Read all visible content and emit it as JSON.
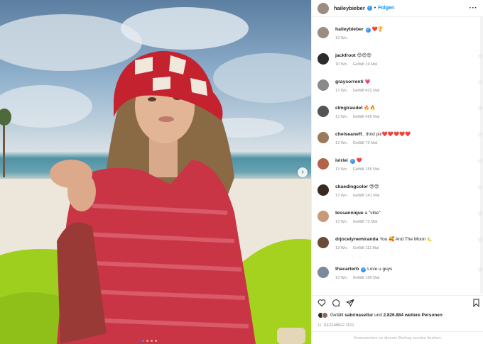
{
  "post": {
    "author": "haileybieber",
    "follow_label": "Folgen",
    "more_label": "···",
    "carousel_next": "›"
  },
  "caption": {
    "user": "haileybieber",
    "text": "❤️🏆",
    "age": "13 Wo."
  },
  "comments": [
    {
      "user": "jackfroot",
      "text": "😍😍😍",
      "age": "10 Wo.",
      "likes": "Gefällt 19 Mal",
      "avatar_color": "#2b2b2b",
      "verified": false
    },
    {
      "user": "graysorrenti",
      "text": "💗",
      "age": "13 Wo.",
      "likes": "Gefällt 422 Mal",
      "avatar_color": "#8a8a8a",
      "verified": false
    },
    {
      "user": "clmgiraudet",
      "text": "🔥🔥",
      "age": "13 Wo.",
      "likes": "Gefällt 495 Mal",
      "avatar_color": "#555555",
      "verified": false
    },
    {
      "user": "chelseaneff_",
      "text": "third pic❤️❤️❤️❤️❤️",
      "age": "13 Wo.",
      "likes": "Gefällt 73 Mal",
      "avatar_color": "#9a7a5a",
      "verified": false
    },
    {
      "user": "ivirlei",
      "text": "❤️",
      "age": "13 Wo.",
      "likes": "Gefällt 155 Mal",
      "avatar_color": "#b5624a",
      "verified": true
    },
    {
      "user": "ckaedingcolor",
      "text": "😍😍",
      "age": "13 Wo.",
      "likes": "Gefällt 141 Mal",
      "avatar_color": "#3a2a22",
      "verified": false
    },
    {
      "user": "tessannique",
      "text": "a \"vibe\"",
      "age": "13 Wo.",
      "likes": "Gefällt 73 Mal",
      "avatar_color": "#c89a7a",
      "verified": false
    },
    {
      "user": "drjocelynemiranda",
      "text": "You 🥰 And The Moon 🌜",
      "age": "13 Wo.",
      "likes": "Gefällt 111 Mal",
      "avatar_color": "#6a4a3a",
      "verified": false
    },
    {
      "user": "thacarterb",
      "text": "Love u guys",
      "age": "13 Wo.",
      "likes": "Gefällt 199 Mal",
      "avatar_color": "#7a8a9a",
      "verified": true
    }
  ],
  "likes_line": {
    "prefix": "Gefällt ",
    "first_user": "sabrinasetlur",
    "middle": " und ",
    "count": "2.826.884 weitere Personen"
  },
  "date": "11. DEZEMBER 2021",
  "comments_closed": "Kommentare zu diesem Beitrag wurden limitiert.",
  "colors": {
    "link_blue": "#0095f6",
    "verified_blue": "#3897f0",
    "meta_gray": "#8e8e8e"
  },
  "icons": [
    "heart-icon",
    "comment-icon",
    "share-icon",
    "bookmark-icon",
    "more-icon",
    "verified-icon",
    "chevron-right-icon"
  ]
}
